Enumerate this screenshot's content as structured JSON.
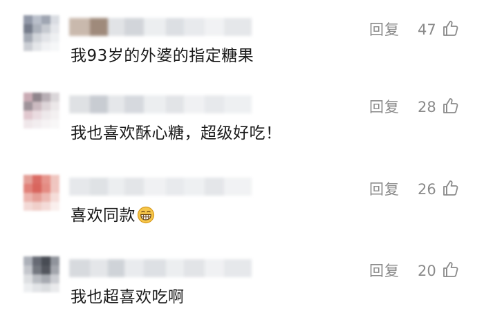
{
  "comments": [
    {
      "text": "我93岁的外婆的指定糖果",
      "reply_label": "回复",
      "likes": "47",
      "has_emoji": false,
      "avatar_tones": [
        "#8c93a3",
        "#b6bcc8",
        "#9aa1ae",
        "#d8dbe1",
        "#6f7685",
        "#a7adb8",
        "#c4c8cf",
        "#e4e6ea",
        "#a0a6b1",
        "#cfd2d8",
        "#e1e3e7",
        "#eef0f2",
        "#c9ccd2",
        "#e3e5e8",
        "#f1f2f4",
        "#f6f7f8"
      ],
      "name_tones": [
        "#c9b9ad",
        "#9f8a7b",
        "#e1e3e6",
        "#d2d5da",
        "#eceef0",
        "#dcdfe3",
        "#e8eaed",
        "#f1f2f4",
        "#e5e7ea"
      ]
    },
    {
      "text": "我也喜欢酥心糖，超级好吃！",
      "reply_label": "回复",
      "likes": "28",
      "has_emoji": false,
      "avatar_tones": [
        "#c7a7b0",
        "#8a7f86",
        "#b4aab0",
        "#d9d4d7",
        "#9a8e95",
        "#c9b7bd",
        "#dcd3d6",
        "#ebe7e8",
        "#e0c6cd",
        "#e9dadf",
        "#eee8ea",
        "#f3f0f1",
        "#efe6e9",
        "#f2edef",
        "#f6f3f4",
        "#f8f7f7"
      ],
      "name_tones": [
        "#dfe1e4",
        "#c8ccd2",
        "#e5e7ea",
        "#d6d9de",
        "#eceef0",
        "#e2e4e7",
        "#f0f1f3",
        "#e7e9ec",
        "#eef0f2"
      ]
    },
    {
      "text": "喜欢同款",
      "reply_label": "回复",
      "likes": "26",
      "has_emoji": true,
      "avatar_tones": [
        "#e39a92",
        "#d9655d",
        "#e58f86",
        "#efc3bd",
        "#e07b72",
        "#d75d55",
        "#e3867d",
        "#f0c4be",
        "#ebb1aa",
        "#e49a92",
        "#ecb6af",
        "#f5dcd8",
        "#f3d8d4",
        "#f0cdc8",
        "#f4dad6",
        "#faefed"
      ],
      "name_tones": [
        "#e6e8eb",
        "#dfe2e5",
        "#eceef0",
        "#e3e5e8",
        "#f0f1f3",
        "#e8eaed",
        "#eef0f2",
        "#e4e6e9",
        "#f1f2f4"
      ]
    },
    {
      "text": "我也超喜欢吃啊",
      "reply_label": "回复",
      "likes": "20",
      "has_emoji": false,
      "avatar_tones": [
        "#a9adb6",
        "#5f636d",
        "#3f434b",
        "#8b8f97",
        "#c1c4ca",
        "#6d717a",
        "#4a4e56",
        "#9ea1a8",
        "#dcdee1",
        "#b7bac0",
        "#a3a6ad",
        "#c9cbd0",
        "#eceef0",
        "#e1e3e6",
        "#dadcdf",
        "#e8e9eb"
      ],
      "name_tones": [
        "#d7dade",
        "#e4e6e9",
        "#cfd3d8",
        "#e9ebee",
        "#dde0e4",
        "#eceef0",
        "#e2e4e7",
        "#f0f1f3",
        "#e6e8eb"
      ]
    }
  ]
}
